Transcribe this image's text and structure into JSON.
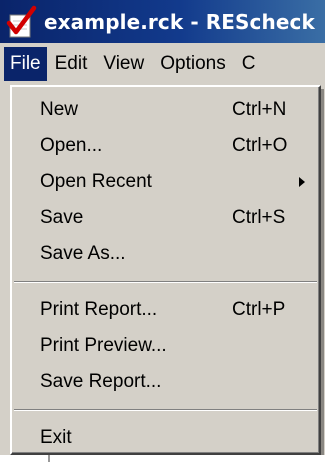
{
  "window": {
    "title": "example.rck - REScheck"
  },
  "menubar": {
    "items": [
      {
        "label": "File",
        "active": true
      },
      {
        "label": "Edit"
      },
      {
        "label": "View"
      },
      {
        "label": "Options"
      },
      {
        "label": "C"
      }
    ]
  },
  "file_menu": {
    "groups": [
      {
        "items": [
          {
            "label": "New",
            "shortcut": "Ctrl+N"
          },
          {
            "label": "Open...",
            "shortcut": "Ctrl+O"
          },
          {
            "label": "Open Recent",
            "submenu": true
          },
          {
            "label": "Save",
            "shortcut": "Ctrl+S"
          },
          {
            "label": "Save As..."
          }
        ]
      },
      {
        "items": [
          {
            "label": "Print Report...",
            "shortcut": "Ctrl+P"
          },
          {
            "label": "Print Preview..."
          },
          {
            "label": "Save Report..."
          }
        ]
      },
      {
        "items": [
          {
            "label": "Exit"
          }
        ]
      }
    ]
  },
  "colors": {
    "title_bar": "#0a246a",
    "menu_background": "#d4d0c8",
    "highlight": "#0a246a",
    "app_icon_check": "#d10000"
  },
  "icons": {
    "app": "red-checkmark-document-icon",
    "submenu": "submenu-arrow-icon"
  }
}
